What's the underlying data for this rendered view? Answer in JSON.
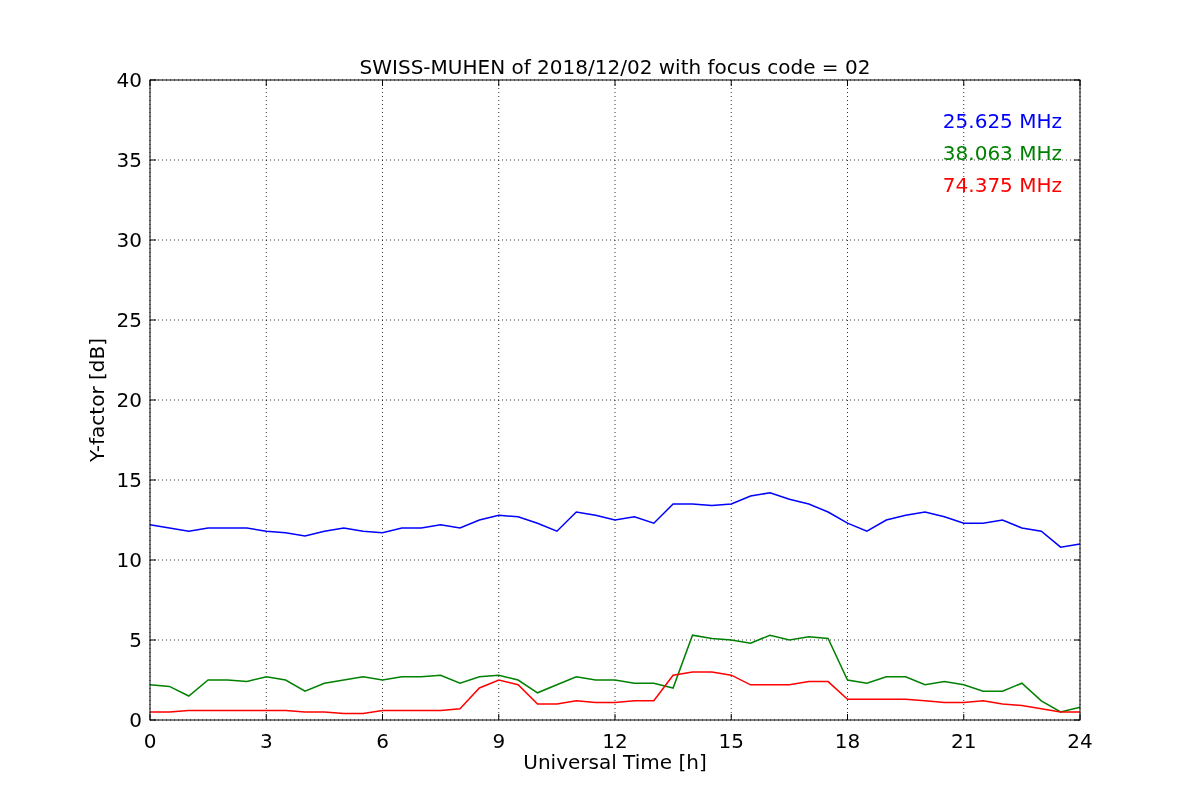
{
  "chart_data": {
    "type": "line",
    "title": "SWISS-MUHEN of 2018/12/02 with focus code = 02",
    "xlabel": "Universal Time [h]",
    "ylabel": "Y-factor [dB]",
    "x": [
      0,
      0.5,
      1,
      1.5,
      2,
      2.5,
      3,
      3.5,
      4,
      4.5,
      5,
      5.5,
      6,
      6.5,
      7,
      7.5,
      8,
      8.5,
      9,
      9.5,
      10,
      10.5,
      11,
      11.5,
      12,
      12.5,
      13,
      13.5,
      14,
      14.5,
      15,
      15.5,
      16,
      16.5,
      17,
      17.5,
      18,
      18.5,
      19,
      19.5,
      20,
      20.5,
      21,
      21.5,
      22,
      22.5,
      23,
      23.5,
      24
    ],
    "series": [
      {
        "name": "25.625 MHz",
        "color": "#0000ff",
        "values": [
          12.2,
          12,
          11.8,
          12,
          12,
          12,
          11.8,
          11.7,
          11.5,
          11.8,
          12,
          11.8,
          11.7,
          12,
          12,
          12.2,
          12,
          12.5,
          12.8,
          12.7,
          12.3,
          11.8,
          13,
          12.8,
          12.5,
          12.7,
          12.3,
          13.5,
          13.5,
          13.4,
          13.5,
          14,
          14.2,
          13.8,
          13.5,
          13,
          12.3,
          11.8,
          12.5,
          12.8,
          13,
          12.7,
          12.3,
          12.3,
          12.5,
          12,
          11.8,
          10.8,
          11
        ]
      },
      {
        "name": "38.063 MHz",
        "color": "#008000",
        "values": [
          2.2,
          2.1,
          1.5,
          2.5,
          2.5,
          2.4,
          2.7,
          2.5,
          1.8,
          2.3,
          2.5,
          2.7,
          2.5,
          2.7,
          2.7,
          2.8,
          2.3,
          2.7,
          2.8,
          2.5,
          1.7,
          2.2,
          2.7,
          2.5,
          2.5,
          2.3,
          2.3,
          2,
          5.3,
          5.1,
          5,
          4.8,
          5.3,
          5,
          5.2,
          5.1,
          2.5,
          2.3,
          2.7,
          2.7,
          2.2,
          2.4,
          2.2,
          1.8,
          1.8,
          2.3,
          1.2,
          0.5,
          0.8
        ]
      },
      {
        "name": "74.375 MHz",
        "color": "#ff0000",
        "values": [
          0.5,
          0.5,
          0.6,
          0.6,
          0.6,
          0.6,
          0.6,
          0.6,
          0.5,
          0.5,
          0.4,
          0.4,
          0.6,
          0.6,
          0.6,
          0.6,
          0.7,
          2,
          2.5,
          2.2,
          1,
          1,
          1.2,
          1.1,
          1.1,
          1.2,
          1.2,
          2.8,
          3,
          3,
          2.8,
          2.2,
          2.2,
          2.2,
          2.4,
          2.4,
          1.3,
          1.3,
          1.3,
          1.3,
          1.2,
          1.1,
          1.1,
          1.2,
          1,
          0.9,
          0.7,
          0.5,
          0.5
        ]
      }
    ],
    "xlim": [
      0,
      24
    ],
    "ylim": [
      0,
      40
    ],
    "grid": true,
    "xticks": [
      0,
      3,
      6,
      9,
      12,
      15,
      18,
      21,
      24
    ],
    "yticks": [
      0,
      5,
      10,
      15,
      20,
      25,
      30,
      35,
      40
    ]
  }
}
